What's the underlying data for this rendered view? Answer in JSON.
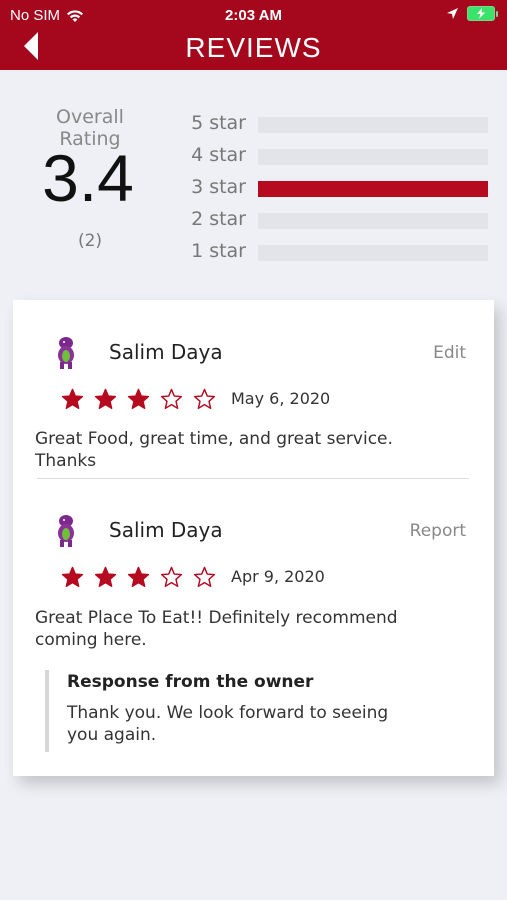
{
  "status_bar": {
    "carrier": "No SIM",
    "time": "2:03 AM"
  },
  "header": {
    "title": "REVIEWS",
    "color": "#a5081c"
  },
  "summary": {
    "label": "Overall Rating",
    "value": "3.4",
    "count": "(2)",
    "breakdown": [
      {
        "label": "5 star",
        "fraction": 0
      },
      {
        "label": "4 star",
        "fraction": 0
      },
      {
        "label": "3 star",
        "fraction": 1
      },
      {
        "label": "2 star",
        "fraction": 0
      },
      {
        "label": "1 star",
        "fraction": 0
      }
    ]
  },
  "reviews": [
    {
      "name": "Salim Daya",
      "action": "Edit",
      "rating": 3,
      "max_rating": 5,
      "date": "May 6, 2020",
      "comment": "Great Food, great time, and great service. Thanks"
    },
    {
      "name": "Salim Daya",
      "action": "Report",
      "rating": 3,
      "max_rating": 5,
      "date": "Apr 9, 2020",
      "comment": "Great Place To Eat!! Definitely recommend coming here.",
      "owner_response": {
        "title": "Response from the owner",
        "text": "Thank you. We look forward to seeing you again."
      }
    }
  ],
  "icons": {
    "back": "back-arrow-icon",
    "wifi": "wifi-icon",
    "location": "location-arrow-icon",
    "battery": "battery-charging-icon",
    "star_filled": "star-filled-icon",
    "star_empty": "star-outline-icon",
    "avatar": "purple-dinosaur-avatar"
  },
  "accent_color": "#b50a1f"
}
